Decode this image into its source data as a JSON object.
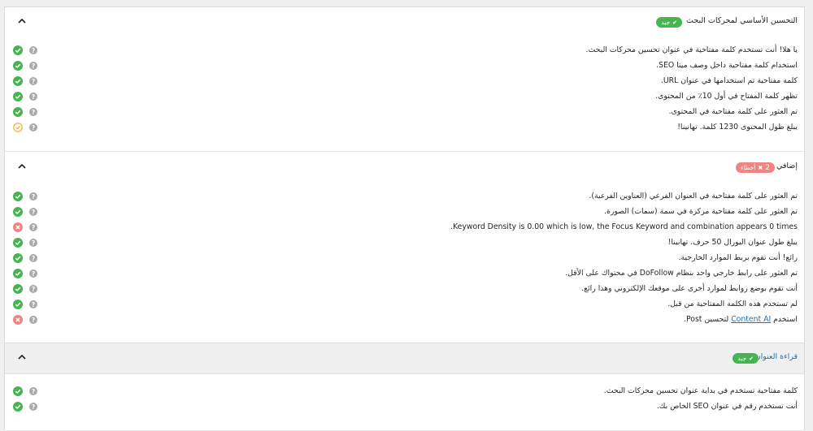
{
  "sections": [
    {
      "title": "التحسين الأساسي لمحركات البحث",
      "badge": {
        "label": "جيد",
        "status": "good"
      },
      "items": [
        {
          "text": "يا هلا! أنت تستخدم كلمة مفتاحية في عنوان تحسين محركات البحث.",
          "status": "pass"
        },
        {
          "text": "استخدام كلمة مفتاحية داخل وصف ميتا SEO.",
          "status": "pass"
        },
        {
          "text": "كلمة مفتاحية تم استخدامها في عنوان URL.",
          "status": "pass"
        },
        {
          "text": "تظهر كلمة المفتاح في أول 10٪ من المحتوى.",
          "status": "pass"
        },
        {
          "text": "تم العثور على كلمة مفتاحية في المحتوى.",
          "status": "pass"
        },
        {
          "text": "يبلغ طول المحتوى 1230 كلمة. تهانينا!",
          "status": "warn"
        }
      ]
    },
    {
      "title": "إضافي",
      "badge": {
        "count": "2",
        "label": "أخطاء",
        "status": "bad"
      },
      "items": [
        {
          "text": "تم العثور على كلمة مفتاحية في العنوان الفرعي (العناوين الفرعية).",
          "status": "pass"
        },
        {
          "text": "تم العثور على كلمة مفتاحية مركزة في سمة (سمات) الصورة.",
          "status": "pass"
        },
        {
          "text": "Keyword Density is 0.00 which is low, the Focus Keyword and combination appears 0 times.",
          "status": "fail"
        },
        {
          "text": "يبلغ طول عنوان اليورال 50 حرف. تهانينا!",
          "status": "pass"
        },
        {
          "text": "رائع! أنت تقوم بربط الموارد الخارجية.",
          "status": "pass"
        },
        {
          "text": "تم العثور على رابط خارجي واحد بنظام DoFollow في محتواك على الأقل.",
          "status": "pass"
        },
        {
          "text": "أنت تقوم بوضع روابط لموارد أخرى على موقعك الإلكتروني وهذا رائع.",
          "status": "pass"
        },
        {
          "text": "لم تستخدم هذه الكلمة المفتاحية من قبل.",
          "status": "pass"
        },
        {
          "text_before": "استخدم ",
          "link": "Content AI",
          "text_after": " لتحسين Post.",
          "status": "fail"
        }
      ]
    },
    {
      "title": "قراءة العنوان",
      "badge": {
        "label": "جيد",
        "status": "good"
      },
      "items": [
        {
          "text": "كلمة مفتاحية تستخدم في بداية عنوان تحسين محركات البحث.",
          "status": "pass"
        },
        {
          "text": "أنت تستخدم رقم في عنوان SEO الخاص بك.",
          "status": "pass"
        }
      ]
    }
  ],
  "colors": {
    "pass": "#46b450",
    "fail": "#ee8585",
    "warn": "#f0b849",
    "help": "#a7aaad",
    "link": "#2271b1"
  },
  "icons": {
    "pass": "check-circle-icon",
    "fail": "x-circle-icon",
    "warn": "check-circle-outline-icon",
    "help": "question-circle-icon",
    "toggle": "chevron-up-icon"
  }
}
